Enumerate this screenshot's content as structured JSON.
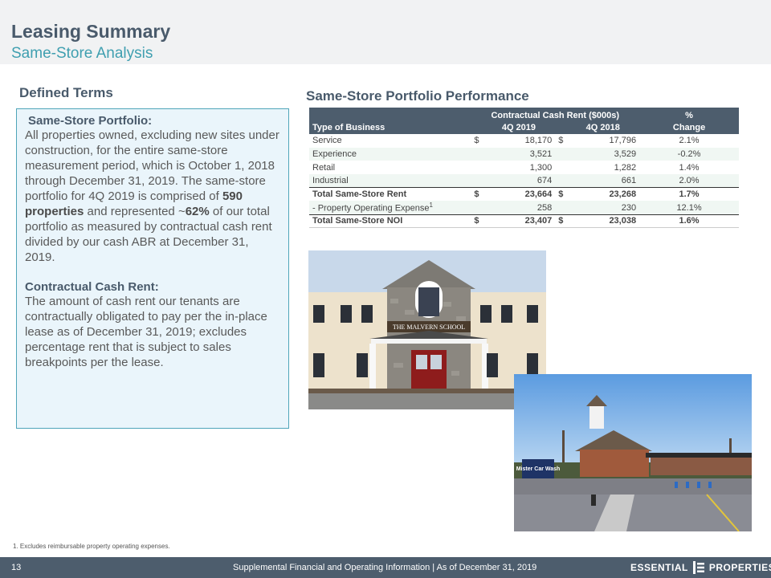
{
  "header": {
    "title": "Leasing Summary",
    "subtitle": "Same-Store Analysis"
  },
  "defined_terms": {
    "heading": "Defined Terms",
    "same_store": {
      "title": "Same-Store Portfolio:",
      "text_1": "All properties owned, excluding new sites under construction, for the entire same-store measurement period, which is October 1, 2018 through December 31, 2019. The same-store portfolio for 4Q 2019 is comprised of ",
      "bold_1": "590 properties",
      "text_2": " and represented ~",
      "bold_2": "62%",
      "text_3": " of our total portfolio as measured by contractual cash rent divided by our cash ABR at December 31, 2019."
    },
    "contractual": {
      "title": "Contractual Cash Rent:",
      "text": "The amount of cash rent our tenants are contractually obligated to pay per the in-place lease as of December 31, 2019; excludes percentage rent that is subject to sales breakpoints per the lease."
    }
  },
  "performance": {
    "heading": "Same-Store Portfolio Performance",
    "header_group": "Contractual Cash Rent ($000s)",
    "header_pct": "%",
    "col_type": "Type of Business",
    "col_q4_2019": "4Q 2019",
    "col_q4_2018": "4Q 2018",
    "col_change": "Change",
    "rows": [
      {
        "name": "Service",
        "d1": "$",
        "v2019": "18,170",
        "d2": "$",
        "v2018": "17,796",
        "change": "2.1%"
      },
      {
        "name": "Experience",
        "d1": "",
        "v2019": "3,521",
        "d2": "",
        "v2018": "3,529",
        "change": "-0.2%"
      },
      {
        "name": "Retail",
        "d1": "",
        "v2019": "1,300",
        "d2": "",
        "v2018": "1,282",
        "change": "1.4%"
      },
      {
        "name": "Industrial",
        "d1": "",
        "v2019": "674",
        "d2": "",
        "v2018": "661",
        "change": "2.0%"
      }
    ],
    "total_rent": {
      "name": "Total Same-Store Rent",
      "d1": "$",
      "v2019": "23,664",
      "d2": "$",
      "v2018": "23,268",
      "change": "1.7%"
    },
    "opex": {
      "name": "- Property Operating Expense",
      "sup": "1",
      "v2019": "258",
      "v2018": "230",
      "change": "12.1%"
    },
    "total_noi": {
      "name": "Total Same-Store NOI",
      "d1": "$",
      "v2019": "23,407",
      "d2": "$",
      "v2018": "23,038",
      "change": "1.6%"
    }
  },
  "images": {
    "photo1": {
      "sign": "THE MALVERN SCHOOL"
    },
    "photo2": {
      "sign": "Mister Car Wash"
    }
  },
  "footnote": "1. Excludes reimbursable property operating expenses.",
  "footer": {
    "page": "13",
    "text": "Supplemental Financial and Operating Information | As of December 31, 2019",
    "logo_left": "ESSENTIAL",
    "logo_right": "PROPERTIES"
  },
  "colors": {
    "title": "#495a6b",
    "subtitle": "#3f9fb0",
    "band": "#4d5d6d",
    "box_fill": "#eaf5fb",
    "box_border": "#4fa5b9"
  }
}
